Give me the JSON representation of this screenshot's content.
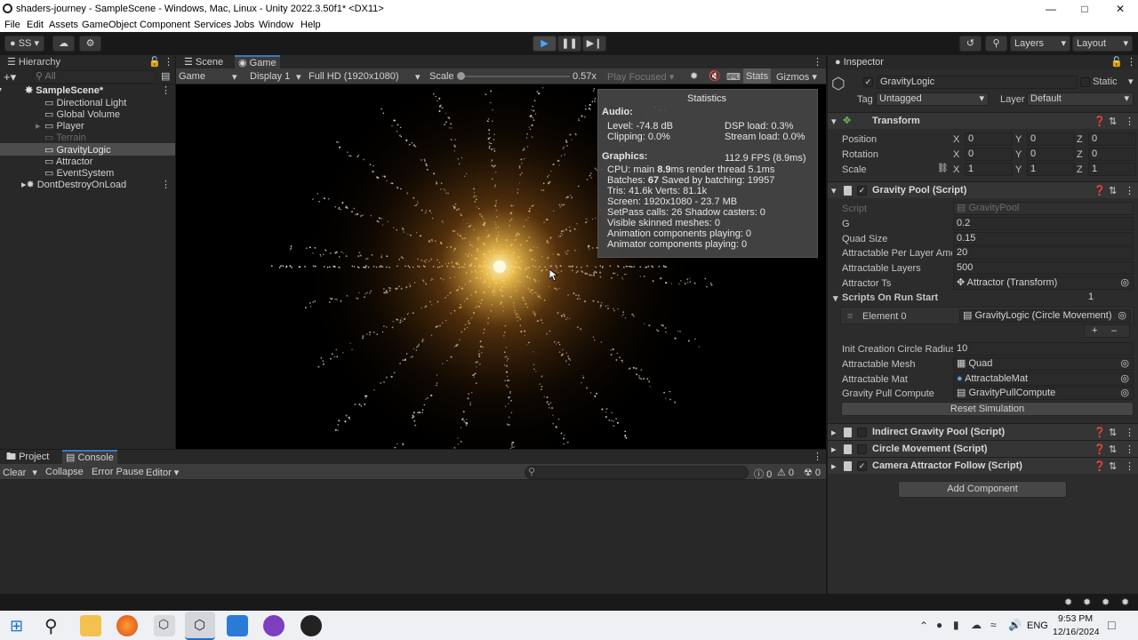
{
  "window": {
    "title": "shaders-journey - SampleScene - Windows, Mac, Linux - Unity 2022.3.50f1* <DX11>"
  },
  "menu": [
    "File",
    "Edit",
    "Assets",
    "GameObject",
    "Component",
    "Services",
    "Jobs",
    "Window",
    "Help"
  ],
  "toolbar": {
    "account": "SS",
    "layers": "Layers",
    "layout": "Layout"
  },
  "hierarchy": {
    "tab": "Hierarchy",
    "search_placeholder": "All",
    "scene": "SampleScene*",
    "items": [
      "Directional Light",
      "Global Volume",
      "Player",
      "Terrain",
      "GravityLogic",
      "Attractor",
      "EventSystem"
    ],
    "dontdestroy": "DontDestroyOnLoad"
  },
  "game": {
    "tab_scene": "Scene",
    "tab_game": "Game",
    "mode": "Game",
    "display": "Display 1",
    "resolution": "Full HD (1920x1080)",
    "scale_label": "Scale",
    "scale_value": "0.57x",
    "play_focused": "Play Focused",
    "stats_btn": "Stats",
    "gizmos": "Gizmos"
  },
  "stats": {
    "title": "Statistics",
    "audio": "Audio:",
    "level": "Level: -74.8 dB",
    "clipping": "Clipping: 0.0%",
    "dsp": "DSP load: 0.3%",
    "stream": "Stream load: 0.0%",
    "graphics": "Graphics:",
    "fps": "112.9 FPS (8.9ms)",
    "cpu_a": "CPU: main ",
    "cpu_b": "8.9",
    "cpu_c": "ms  render thread 5.1ms",
    "batches_a": "Batches: ",
    "batches_b": "67",
    "batches_c": "    Saved by batching: 19957",
    "tris": "Tris: 41.6k        Verts: 81.1k",
    "screen": "Screen: 1920x1080 - 23.7 MB",
    "setpass": "SetPass calls: 26          Shadow casters: 0",
    "skinned": "Visible skinned meshes: 0",
    "anim": "Animation components playing: 0",
    "animator": "Animator components playing: 0"
  },
  "console": {
    "tab_project": "Project",
    "tab_console": "Console",
    "clear": "Clear",
    "collapse": "Collapse",
    "error_pause": "Error Pause",
    "editor": "Editor",
    "count_info": "0",
    "count_warn": "0",
    "count_err": "0"
  },
  "inspector": {
    "tab": "Inspector",
    "object_name": "GravityLogic",
    "static": "Static",
    "tag_label": "Tag",
    "tag": "Untagged",
    "layer_label": "Layer",
    "layer": "Default",
    "transform": {
      "name": "Transform",
      "position": "Position",
      "rotation": "Rotation",
      "scale": "Scale",
      "pos": [
        "0",
        "0",
        "0"
      ],
      "rot": [
        "0",
        "0",
        "0"
      ],
      "scl": [
        "1",
        "1",
        "1"
      ],
      "axes": [
        "X",
        "Y",
        "Z"
      ]
    },
    "gravity_pool": {
      "name": "Gravity Pool (Script)",
      "script_label": "Script",
      "script": "GravityPool",
      "g_label": "G",
      "g": "0.2",
      "quad_label": "Quad Size",
      "quad": "0.15",
      "per_layer_label": "Attractable Per Layer Amc",
      "per_layer": "20",
      "layers_label": "Attractable Layers",
      "layers": "500",
      "attractor_label": "Attractor Ts",
      "attractor": "Attractor (Transform)",
      "scripts_label": "Scripts On Run Start",
      "scripts_count": "1",
      "element_label": "Element 0",
      "element": "GravityLogic (Circle Movement)",
      "radius_label": "Init Creation Circle Radius",
      "radius": "10",
      "mesh_label": "Attractable Mesh",
      "mesh": "Quad",
      "mat_label": "Attractable Mat",
      "mat": "AttractableMat",
      "compute_label": "Gravity Pull Compute",
      "compute": "GravityPullCompute",
      "reset": "Reset Simulation"
    },
    "components": [
      "Indirect Gravity Pool (Script)",
      "Circle Movement (Script)",
      "Camera Attractor Follow (Script)"
    ],
    "add_component": "Add Component"
  },
  "taskbar": {
    "lang": "ENG",
    "time": "9:53 PM",
    "date": "12/16/2024"
  }
}
